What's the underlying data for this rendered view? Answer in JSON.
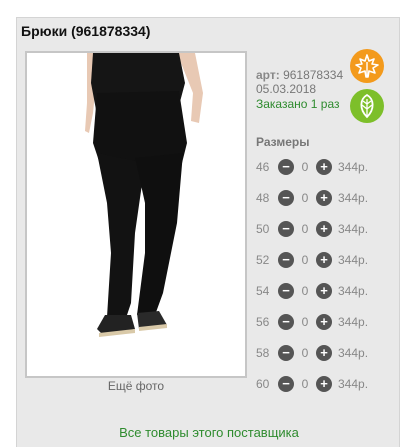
{
  "product": {
    "title": "Брюки (961878334)",
    "art_label": "арт:",
    "art_value": "961878334",
    "date": "05.03.2018",
    "ordered": "Заказано 1 раз",
    "more_photo": "Ещё фото"
  },
  "badges": {
    "autumn": {
      "icon": "maple-leaf-icon",
      "color": "#f39a1c"
    },
    "spring": {
      "icon": "leaf-icon",
      "color": "#7dbf2a"
    }
  },
  "sizes": {
    "header": "Размеры",
    "rows": [
      {
        "size": "46",
        "qty": "0",
        "price": "344р."
      },
      {
        "size": "48",
        "qty": "0",
        "price": "344р."
      },
      {
        "size": "50",
        "qty": "0",
        "price": "344р."
      },
      {
        "size": "52",
        "qty": "0",
        "price": "344р."
      },
      {
        "size": "54",
        "qty": "0",
        "price": "344р."
      },
      {
        "size": "56",
        "qty": "0",
        "price": "344р."
      },
      {
        "size": "58",
        "qty": "0",
        "price": "344р."
      },
      {
        "size": "60",
        "qty": "0",
        "price": "344р."
      }
    ]
  },
  "footer": {
    "supplier_link": "Все товары этого поставщика"
  },
  "colors": {
    "green_text": "#2e8b2e",
    "panel_bg": "#e9e9e9"
  }
}
